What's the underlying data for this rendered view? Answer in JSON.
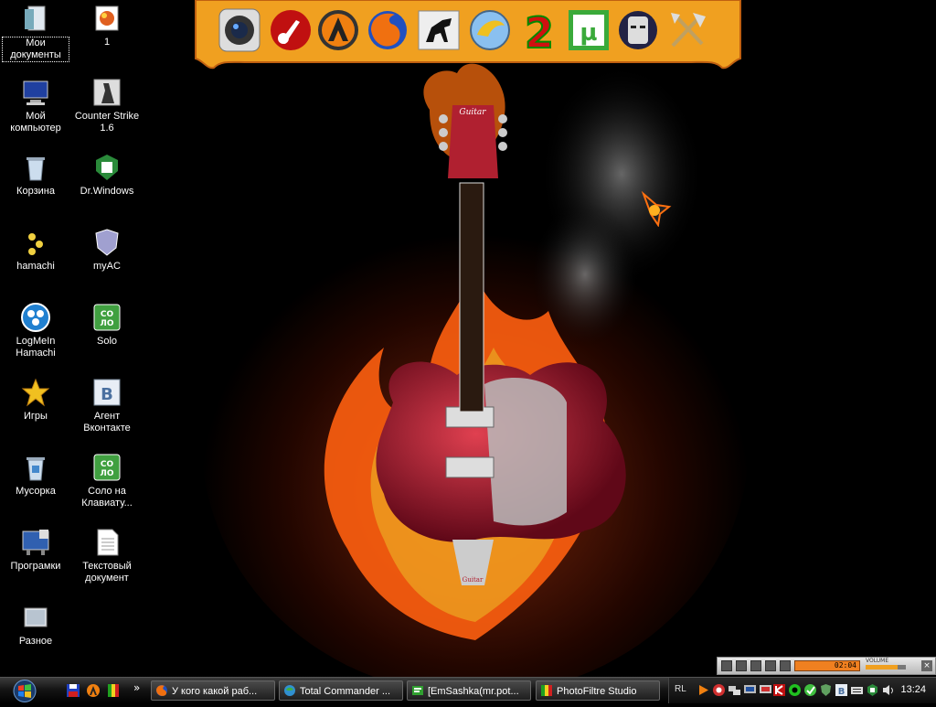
{
  "desktop": {
    "icons": [
      {
        "label": "Мои документы",
        "icon": "my-documents-icon"
      },
      {
        "label": "1",
        "icon": "image-file-icon"
      },
      {
        "label": "Мой компьютер",
        "icon": "my-computer-icon"
      },
      {
        "label": "Counter Strike 1.6",
        "icon": "counter-strike-icon"
      },
      {
        "label": "Корзина",
        "icon": "recycle-bin-icon"
      },
      {
        "label": "Dr.Windows",
        "icon": "dr-windows-icon"
      },
      {
        "label": "hamachi",
        "icon": "hamachi-icon"
      },
      {
        "label": "myAC",
        "icon": "myac-shield-icon"
      },
      {
        "label": "LogMeIn Hamachi",
        "icon": "logmein-hamachi-icon"
      },
      {
        "label": "Solo",
        "icon": "solo-icon"
      },
      {
        "label": "Игры",
        "icon": "star-icon"
      },
      {
        "label": "Агент Вконтакте",
        "icon": "vkontakte-icon"
      },
      {
        "label": "Мусорка",
        "icon": "recycle-bin-icon"
      },
      {
        "label": "Соло на Клавиату...",
        "icon": "solo-keyboard-icon"
      },
      {
        "label": "Програмки",
        "icon": "programs-icon"
      },
      {
        "label": "Текстовый документ",
        "icon": "text-document-icon"
      },
      {
        "label": "Разное",
        "icon": "folder-icon"
      }
    ]
  },
  "dock": {
    "items": [
      {
        "icon": "webcam-icon"
      },
      {
        "icon": "guitar-red-icon"
      },
      {
        "icon": "aimp-icon"
      },
      {
        "icon": "firefox-icon"
      },
      {
        "icon": "horse-icon"
      },
      {
        "icon": "qip-icon"
      },
      {
        "icon": "number-two-icon"
      },
      {
        "icon": "utorrent-icon"
      },
      {
        "icon": "mask-icon"
      },
      {
        "icon": "tools-axe-icon"
      }
    ],
    "colors": {
      "background": "#f0a020",
      "border": "#c06010"
    }
  },
  "taskbar": {
    "quick_launch": [
      {
        "icon": "floppy-icon"
      },
      {
        "icon": "aimp-small-icon"
      },
      {
        "icon": "photofiltre-small-icon"
      }
    ],
    "overflow_glyph": "»",
    "tasks": [
      {
        "label": "У кого какой раб...",
        "icon": "firefox-icon"
      },
      {
        "label": "Total Commander ...",
        "icon": "globe-icon"
      },
      {
        "label": "[EmSashka(mr.pot...",
        "icon": "chat-icon"
      },
      {
        "label": "PhotoFiltre Studio",
        "icon": "photofiltre-icon"
      }
    ],
    "tray": {
      "language": "RL",
      "icons": [
        "aimp-tray-icon",
        "utorrent-tray-icon",
        "network-icon",
        "display-icon",
        "monitor-icon",
        "kaspersky-icon",
        "green-circle-icon",
        "checkmark-icon",
        "shield-icon",
        "vkontakte-tray-icon",
        "keyboard-icon",
        "drwindows-tray-icon",
        "speaker-icon"
      ],
      "time": "13:24"
    }
  },
  "mini_player": {
    "time": "02:04",
    "volume_label": "VOLUME",
    "volume_level": 0.8
  }
}
